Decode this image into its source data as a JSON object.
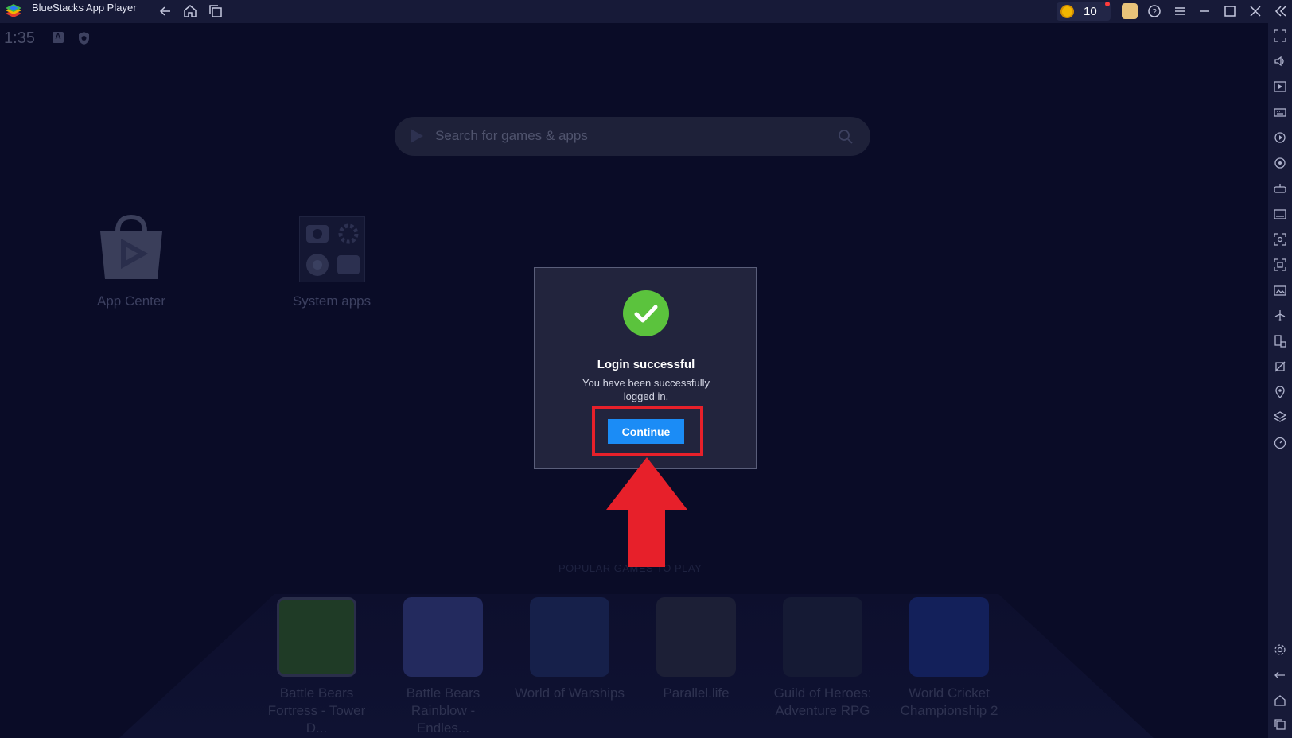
{
  "titlebar": {
    "app_title": "BlueStacks App Player",
    "coins": "10",
    "icons": [
      "back-icon",
      "home-icon",
      "multi-instance-icon",
      "help-icon",
      "menu-icon",
      "minimize-icon",
      "maximize-icon",
      "close-icon",
      "collapse-sidebar-icon"
    ]
  },
  "status_bar": {
    "time": "1:35",
    "a_badge": "A"
  },
  "search": {
    "placeholder": "Search for games & apps"
  },
  "home_apps": [
    {
      "label": "App Center"
    },
    {
      "label": "System apps"
    }
  ],
  "popular": {
    "heading": "POPULAR GAMES TO PLAY",
    "games": [
      {
        "line1": "Battle Bears",
        "line2": "Fortress - Tower D..."
      },
      {
        "line1": "Battle Bears",
        "line2": "Rainblow - Endles..."
      },
      {
        "line1": "World of Warships",
        "line2": ""
      },
      {
        "line1": "Parallel.life",
        "line2": ""
      },
      {
        "line1": "Guild of Heroes:",
        "line2": "Adventure RPG"
      },
      {
        "line1": "World Cricket",
        "line2": "Championship 2"
      }
    ]
  },
  "dialog": {
    "title": "Login successful",
    "message": "You have been successfully logged in.",
    "button": "Continue"
  },
  "colors": {
    "accent": "#1b8cf6",
    "success": "#5bc33d",
    "highlight": "#e7202a",
    "background": "#0a0c27"
  }
}
